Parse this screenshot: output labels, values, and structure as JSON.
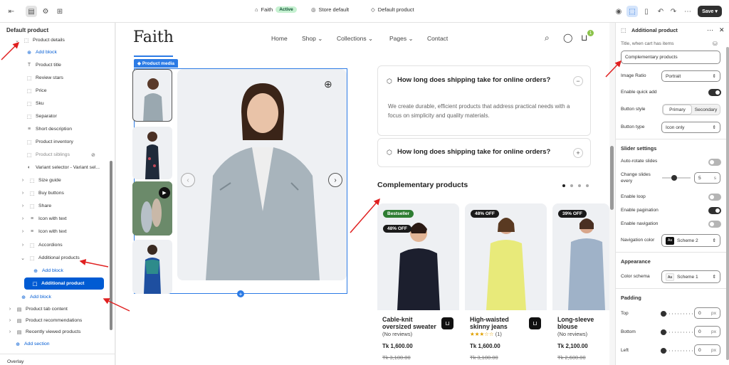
{
  "topbar": {
    "store_name": "Faith",
    "status": "Active",
    "store_default": "Store default",
    "template": "Default product",
    "save": "Save"
  },
  "left": {
    "title": "Default product",
    "items": [
      {
        "label": "Product details"
      },
      {
        "label": "Add block"
      },
      {
        "label": "Product title"
      },
      {
        "label": "Review stars"
      },
      {
        "label": "Price"
      },
      {
        "label": "Sku"
      },
      {
        "label": "Separator"
      },
      {
        "label": "Short description"
      },
      {
        "label": "Product inventory"
      },
      {
        "label": "Product siblings"
      },
      {
        "label": "Variant selector - Variant sel..."
      },
      {
        "label": "Size guide"
      },
      {
        "label": "Buy buttons"
      },
      {
        "label": "Share"
      },
      {
        "label": "Icon with text"
      },
      {
        "label": "Icon with text"
      },
      {
        "label": "Accordions"
      },
      {
        "label": "Additional products"
      },
      {
        "label": "Add block"
      },
      {
        "label": "Additional product"
      },
      {
        "label": "Add block"
      },
      {
        "label": "Product tab content"
      },
      {
        "label": "Product recommendations"
      },
      {
        "label": "Recently viewed products"
      },
      {
        "label": "Add section"
      },
      {
        "label": "Overlay"
      }
    ]
  },
  "preview": {
    "logo": "Faith",
    "nav": [
      "Home",
      "Shop",
      "Collections",
      "Pages",
      "Contact"
    ],
    "cart_count": "1",
    "media_tag": "Product media",
    "accordion": [
      {
        "q": "How long does shipping take for online orders?",
        "a": "We create durable, efficient products that address practical needs with a focus on simplicity and quality materials.",
        "sign": "−"
      },
      {
        "q": "How long does shipping take for online orders?",
        "sign": "+"
      }
    ],
    "comp_title": "Complementary products",
    "cards": [
      {
        "badge": "Bestseller",
        "discount": "48% OFF",
        "name": "Cable-knit oversized sweater",
        "reviews": "(No reviews)",
        "price": "Tk 1,600.00",
        "old": "Tk 3,100.00"
      },
      {
        "discount": "48% OFF",
        "name": "High-waisted skinny jeans",
        "reviews": "(1)",
        "price": "Tk 1,600.00",
        "old": "Tk 3,100.00"
      },
      {
        "discount": "39% OFF",
        "name": "Long-sleeve blouse",
        "reviews": "(No reviews)",
        "price": "Tk 2,100.00",
        "old": "Tk 2,600.00"
      }
    ]
  },
  "right": {
    "title": "Additional product",
    "title_label": "Title, when cart has items",
    "title_value": "Complementary products",
    "image_ratio_label": "Image Ratio",
    "image_ratio": "Portrait",
    "quick_add": "Enable quick add",
    "button_style": "Button style",
    "primary": "Primary",
    "secondary": "Secondary",
    "button_type": "Button type",
    "button_type_value": "Icon only",
    "slider_settings": "Slider settings",
    "autorotate": "Auto-rotate slides",
    "change_every": "Change slides every",
    "change_value": "5",
    "change_unit": "s",
    "loop": "Enable loop",
    "pagination": "Enable pagination",
    "navigation": "Enable navigation",
    "nav_color": "Navigation color",
    "nav_scheme": "Scheme 2",
    "appearance": "Appearance",
    "color_schema": "Color schema",
    "scheme1": "Scheme 1",
    "padding": "Padding",
    "top": "Top",
    "bottom": "Bottom",
    "left": "Left",
    "zero": "0",
    "px": "px"
  }
}
